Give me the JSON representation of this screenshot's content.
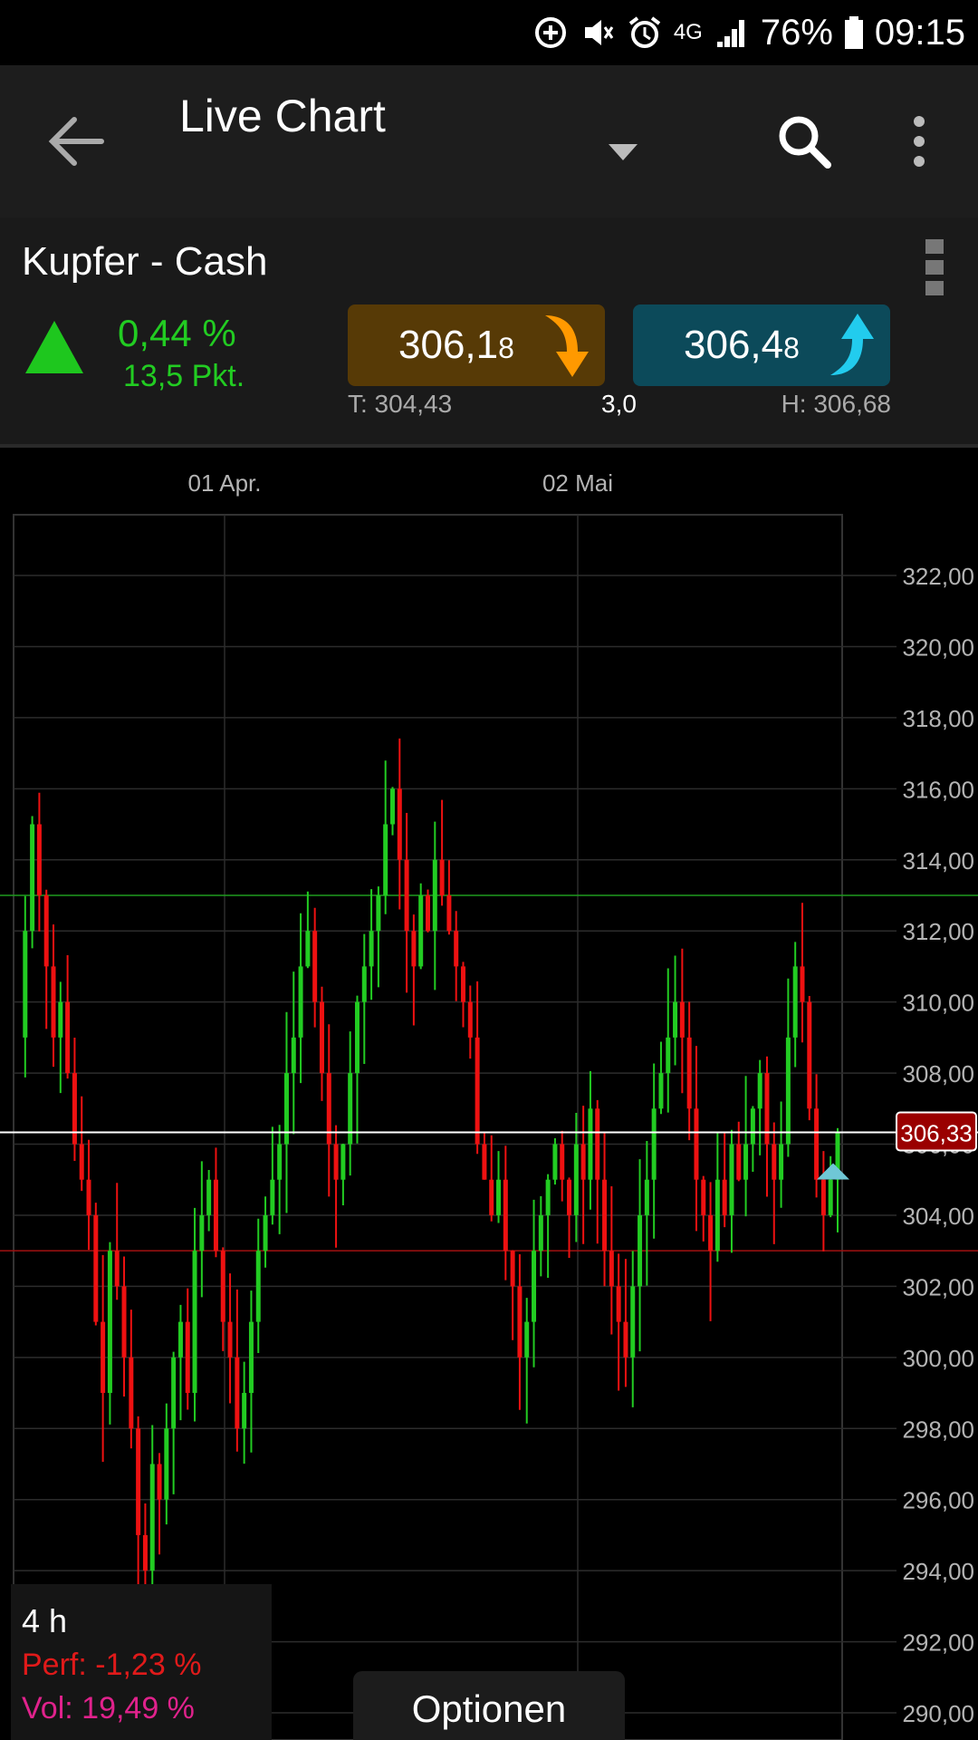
{
  "status_bar": {
    "network": "4G",
    "battery": "76%",
    "time": "09:15"
  },
  "app_bar": {
    "title": "Live Chart",
    "icons": [
      "arrow-left-icon",
      "dropdown-icon",
      "search-icon",
      "more-vert-icon"
    ]
  },
  "quote": {
    "instrument": "Kupfer - Cash",
    "change_pct": "0,44 %",
    "change_pts": "13,5 Pkt.",
    "trend": "up",
    "sell_price_main": "306,1",
    "sell_price_small": "8",
    "buy_price_main": "306,4",
    "buy_price_small": "8",
    "low": "T: 304,43",
    "spread": "3,0",
    "high": "H: 306,68",
    "colors": {
      "up": "#22cc22",
      "sell_bg": "#573a06",
      "buy_bg": "#0c4a5a",
      "sell_arrow": "#ff9900",
      "buy_arrow": "#22ccee"
    }
  },
  "chart_data": {
    "type": "candlestick",
    "x_tick_labels": [
      "01 Apr.",
      "02 Mai"
    ],
    "y_tick_labels": [
      "322,00",
      "320,00",
      "318,00",
      "316,00",
      "314,00",
      "312,00",
      "310,00",
      "308,00",
      "306,00",
      "304,00",
      "302,00",
      "300,00",
      "298,00",
      "296,00",
      "294,00",
      "292,00",
      "290,00"
    ],
    "ylim": [
      290,
      322
    ],
    "current_price_label": "306,33",
    "current_price": 306.33,
    "high_line": 313.0,
    "low_line": 303.0,
    "grid": true,
    "colors": {
      "up": "#22cc22",
      "down": "#ee1111",
      "high_line": "#1f9a1f",
      "low_line": "#a01010",
      "current_line": "#ffffff",
      "price_tag": "#9a0000"
    },
    "closes": [
      309,
      312,
      315,
      313,
      311,
      309,
      310,
      308,
      306,
      305,
      304,
      301,
      299,
      303,
      302,
      300,
      298,
      295,
      294,
      297,
      296,
      298,
      300,
      301,
      299,
      303,
      304,
      305,
      303,
      301,
      300,
      298,
      299,
      301,
      303,
      304,
      305,
      306,
      308,
      309,
      311,
      312,
      310,
      308,
      306,
      305,
      306,
      308,
      310,
      311,
      312,
      313,
      315,
      316,
      314,
      312,
      311,
      313,
      312,
      314,
      313,
      312,
      311,
      310,
      309,
      306,
      305,
      304,
      305,
      303,
      302,
      300,
      301,
      303,
      304,
      305,
      306,
      305,
      304,
      306,
      305,
      307,
      305,
      303,
      302,
      301,
      300,
      302,
      304,
      305,
      307,
      308,
      309,
      310,
      309,
      307,
      305,
      304,
      303,
      305,
      304,
      306,
      305,
      306,
      307,
      308,
      306,
      305,
      306,
      309,
      311,
      310,
      307,
      305,
      304,
      305,
      306.33
    ],
    "bottom_info": {
      "interval": "4 h",
      "perf": "Perf: -1,23 %",
      "vol": "Vol: 19,49 %"
    }
  },
  "options_label": "Optionen"
}
